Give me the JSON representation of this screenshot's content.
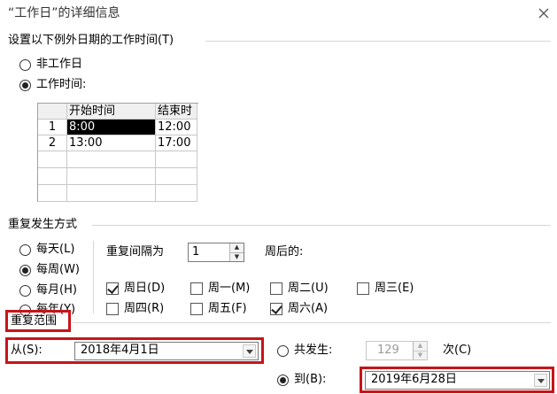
{
  "dialog": {
    "title": "“工作日”的详细信息"
  },
  "work_time_section": {
    "heading": "设置以下例外日期的工作时间(T)",
    "option_nonwork": "非工作日",
    "option_worktime": "工作时间:",
    "selected": "worktime"
  },
  "time_table": {
    "headers": [
      "",
      "开始时间",
      "结束时"
    ],
    "rows": [
      {
        "num": "1",
        "start": "8:00",
        "end": "12:00"
      },
      {
        "num": "2",
        "start": "13:00",
        "end": "17:00"
      }
    ]
  },
  "recurrence": {
    "heading": "重复发生方式",
    "options": [
      "每天(L)",
      "每周(W)",
      "每月(H)",
      "每年(Y)"
    ],
    "selected": "每周(W)",
    "interval_label": "重复间隔为",
    "interval_value": "1",
    "weeks_after_label": "周后的:",
    "days": [
      {
        "label": "周日(D)",
        "checked": true
      },
      {
        "label": "周一(M)",
        "checked": false
      },
      {
        "label": "周二(U)",
        "checked": false
      },
      {
        "label": "周三(E)",
        "checked": false
      },
      {
        "label": "周四(R)",
        "checked": false
      },
      {
        "label": "周五(F)",
        "checked": false
      },
      {
        "label": "周六(A)",
        "checked": true
      }
    ]
  },
  "range": {
    "heading": "重复范围",
    "from_label": "从(S):",
    "from_value": "2018年4月1日",
    "occur_label": "共发生:",
    "occur_value": "129",
    "occur_unit": "次(C)",
    "to_label": "到(B):",
    "to_value": "2019年6月28日",
    "selected": "to"
  },
  "colors": {
    "highlight": "#c7141a",
    "selection": "#000000"
  }
}
